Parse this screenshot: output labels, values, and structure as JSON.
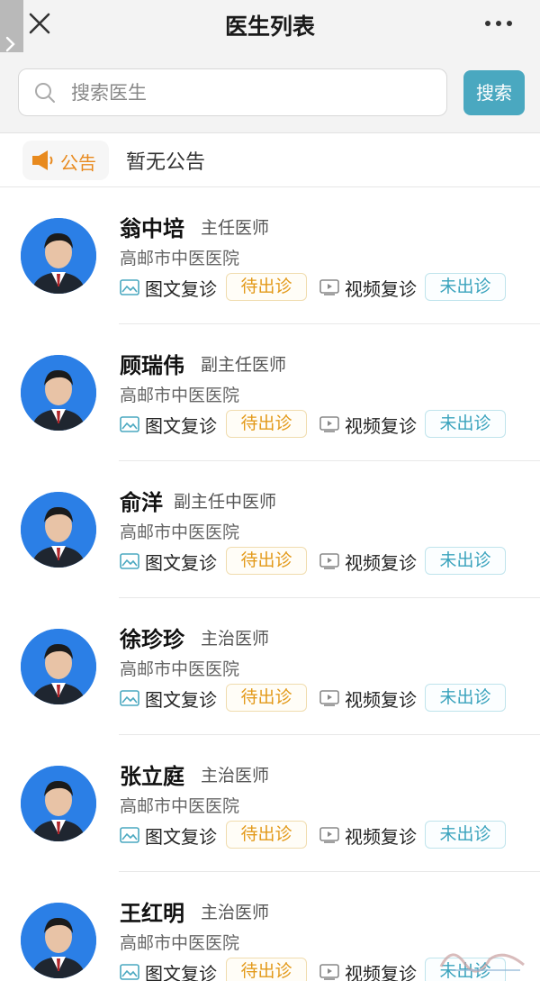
{
  "header": {
    "title": "医生列表",
    "close_icon": "close-icon",
    "more_icon": "more-icon",
    "side_tab_icon": "chevron-right-icon"
  },
  "search": {
    "placeholder": "搜索医生",
    "button_label": "搜索",
    "icon": "search-icon"
  },
  "notice": {
    "label": "公告",
    "text": "暂无公告",
    "icon": "speaker-icon"
  },
  "services": {
    "text_consult_label": "图文复诊",
    "video_consult_label": "视频复诊"
  },
  "doctors": [
    {
      "name": "翁中培",
      "title": "主任医师",
      "hospital": "高邮市中医医院",
      "text_status": "待出诊",
      "video_status": "未出诊"
    },
    {
      "name": "顾瑞伟",
      "title": "副主任医师",
      "hospital": "高邮市中医医院",
      "text_status": "待出诊",
      "video_status": "未出诊"
    },
    {
      "name": "俞洋",
      "title": "副主任中医师",
      "hospital": "高邮市中医医院",
      "text_status": "待出诊",
      "video_status": "未出诊"
    },
    {
      "name": "徐珍珍",
      "title": "主治医师",
      "hospital": "高邮市中医医院",
      "text_status": "待出诊",
      "video_status": "未出诊"
    },
    {
      "name": "张立庭",
      "title": "主治医师",
      "hospital": "高邮市中医医院",
      "text_status": "待出诊",
      "video_status": "未出诊"
    },
    {
      "name": "王红明",
      "title": "主治医师",
      "hospital": "高邮市中医医院",
      "text_status": "待出诊",
      "video_status": "未出诊"
    }
  ],
  "colors": {
    "accent": "#4aa8c0",
    "pending": "#e39a1b",
    "offline": "#3aa3bd",
    "avatar_bg": "#2b7fe6"
  }
}
